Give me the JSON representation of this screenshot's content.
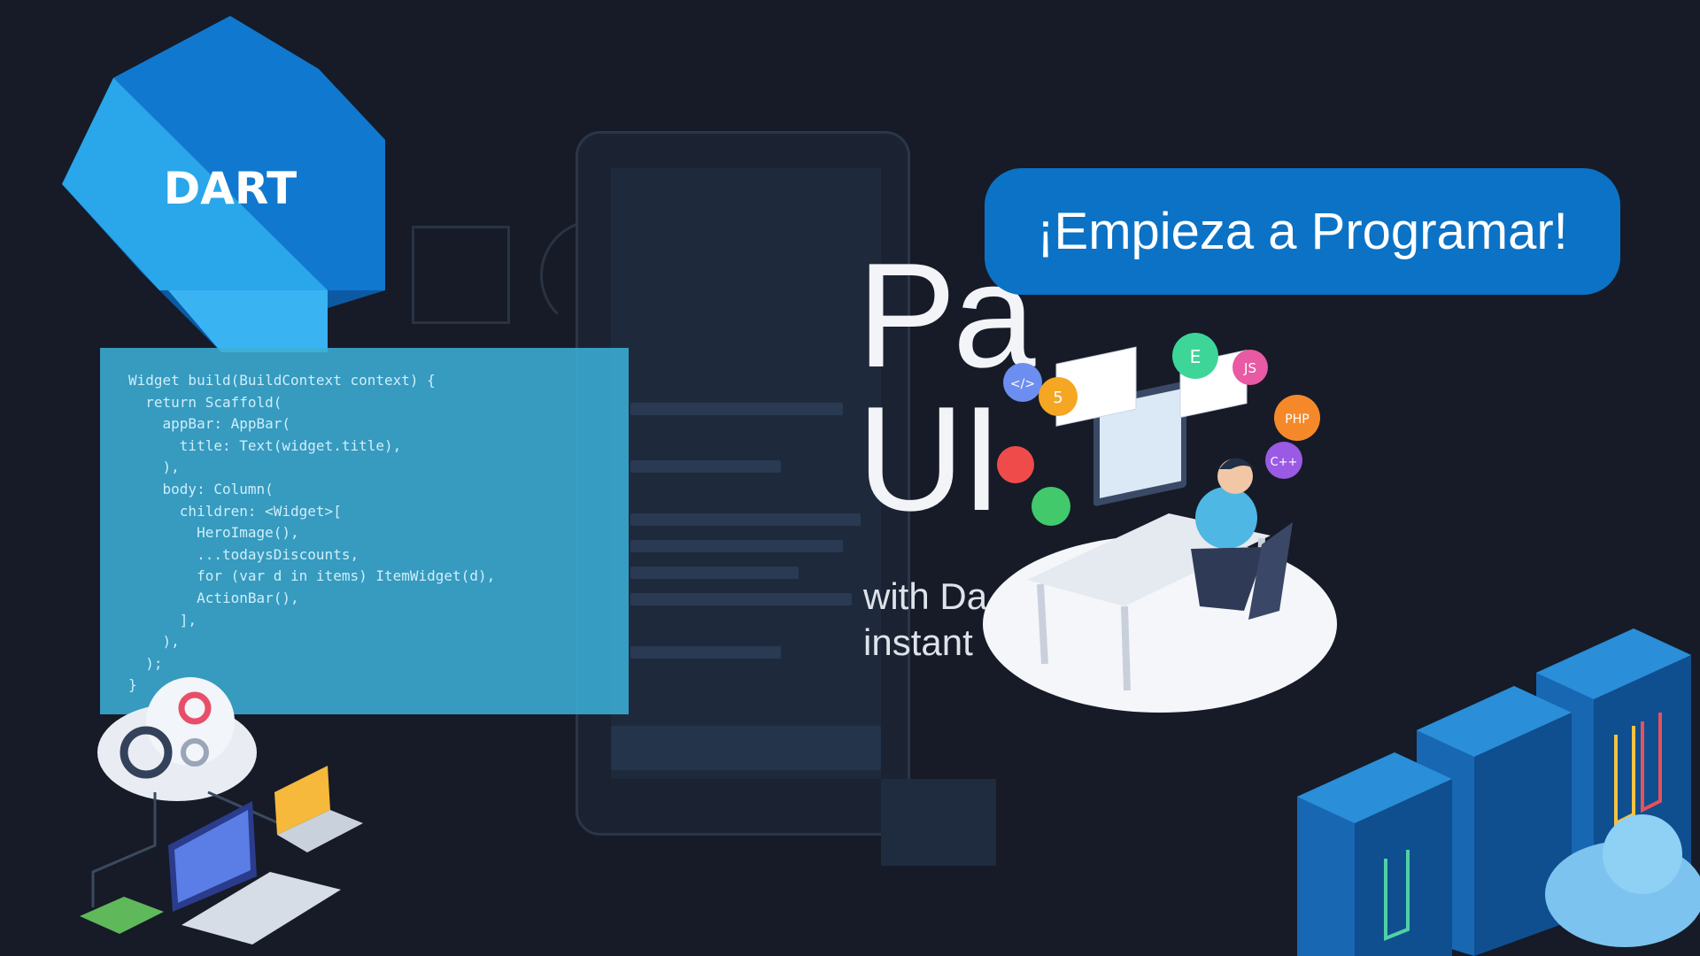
{
  "logo": {
    "text": "DART"
  },
  "headline": {
    "line1": "Pa",
    "line2": "UI"
  },
  "subline": {
    "line1": "with Da",
    "line2": "instant"
  },
  "cta": {
    "label": "¡Empieza a Programar!"
  },
  "code": {
    "text": "Widget build(BuildContext context) {\n  return Scaffold(\n    appBar: AppBar(\n      title: Text(widget.title),\n    ),\n    body: Column(\n      children: <Widget>[\n        HeroImage(),\n        ...todaysDiscounts,\n        for (var d in items) ItemWidget(d),\n        ActionBar(),\n      ],\n    ),\n  );\n}"
  },
  "badges": [
    "</>",
    "5",
    "E",
    "JS",
    "PHP",
    "C++"
  ],
  "colors": {
    "background": "#161b27",
    "cta": "#0b72c6",
    "dart_dark": "#0b5aa3",
    "dart_light": "#3ab3f2",
    "code_panel": "#3db0d8"
  },
  "icons": [
    "dart-logo",
    "developer-illustration",
    "cloud-network-icon",
    "server-rack-icon",
    "cloud-icon"
  ]
}
